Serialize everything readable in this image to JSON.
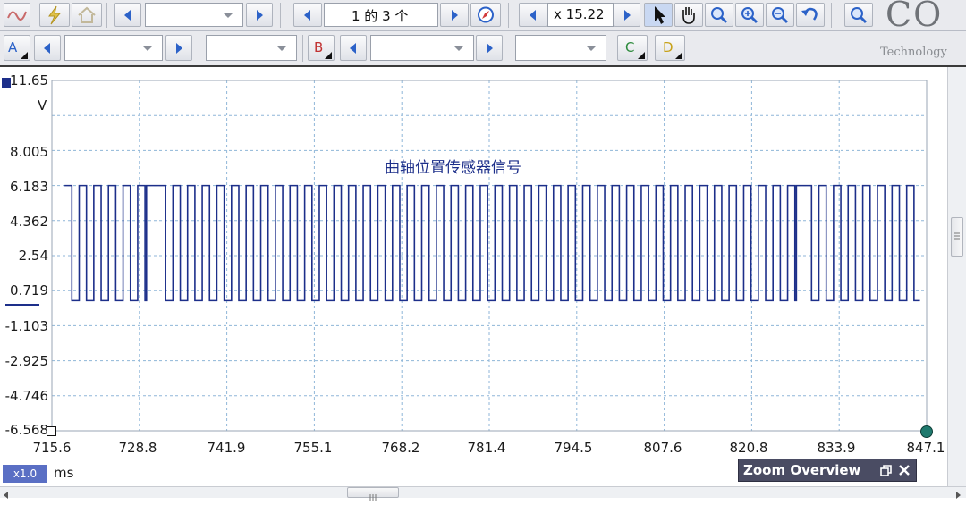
{
  "toolbar_top": {
    "page_counter": "1 的 3 个",
    "zoom_value": "x 15.22",
    "brand_text": "CO",
    "brand_sub": "Technology"
  },
  "channels": {
    "a_label": "A",
    "b_label": "B",
    "c_label": "C",
    "d_label": "D"
  },
  "plot": {
    "title": "曲轴位置传感器信号",
    "y_unit": "V",
    "y_ticks": [
      "11.65",
      "8.005",
      "6.183",
      "4.362",
      "2.54",
      "0.719",
      "-1.103",
      "-2.925",
      "-4.746",
      "-6.568"
    ],
    "x_ticks": [
      "715.6",
      "728.8",
      "741.9",
      "755.1",
      "768.2",
      "781.4",
      "794.5",
      "807.6",
      "820.8",
      "833.9",
      "847.1"
    ],
    "x_unit": "ms",
    "x_multiplier": "x1.0"
  },
  "zoom_overview": {
    "title": "Zoom Overview"
  },
  "chart_data": {
    "type": "line",
    "title": "曲轴位置传感器信号",
    "ylabel": "V",
    "xlabel": "ms",
    "xlim": [
      715.6,
      847.1
    ],
    "ylim": [
      -6.568,
      11.65
    ],
    "grid": true,
    "series": [
      {
        "waveform": "square",
        "high": 6.183,
        "low": 0.2,
        "period_ms": 2.2,
        "duty": 0.5,
        "start": 717.5,
        "end": 846.1,
        "missing_tooth_high": [
          [
            729.6,
            732.7
          ],
          [
            826.7,
            829.8
          ]
        ]
      }
    ]
  },
  "colors": {
    "signal": "#1d2f8a",
    "grid": "#8fb6d8",
    "toolbar_bg": "#e9eaee",
    "accent_blue": "#2c62c8",
    "zoom_overview_bg": "#4a4c63"
  }
}
